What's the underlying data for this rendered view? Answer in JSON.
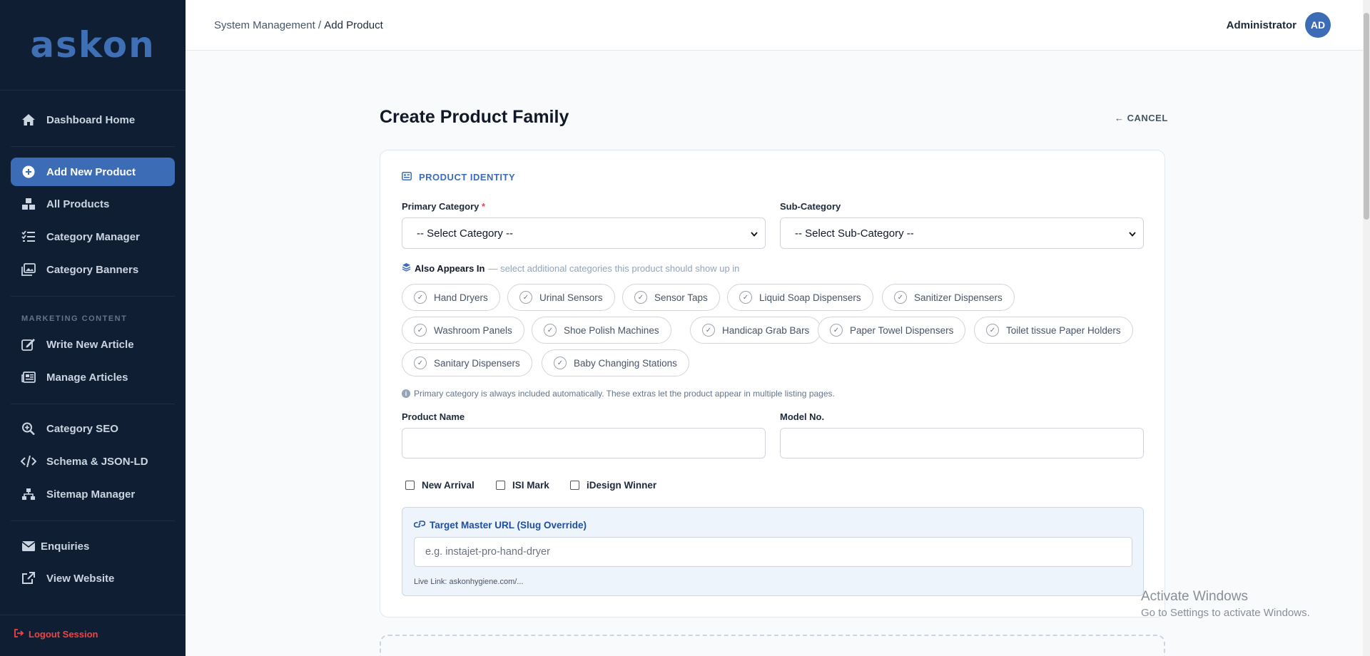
{
  "sidebar": {
    "logo": "askon",
    "items": [
      {
        "label": "Dashboard Home",
        "icon": "home-icon"
      },
      {
        "label": "Add New Product",
        "icon": "plus-circle-icon",
        "active": true
      },
      {
        "label": "All Products",
        "icon": "boxes-icon"
      },
      {
        "label": "Category Manager",
        "icon": "list-check-icon"
      },
      {
        "label": "Category Banners",
        "icon": "images-icon"
      },
      {
        "label": "Write New Article",
        "icon": "edit-icon"
      },
      {
        "label": "Manage Articles",
        "icon": "newspaper-icon"
      },
      {
        "label": "Category SEO",
        "icon": "search-plus-icon"
      },
      {
        "label": "Schema & JSON-LD",
        "icon": "code-icon"
      },
      {
        "label": "Sitemap Manager",
        "icon": "sitemap-icon"
      },
      {
        "label": "Enquiries",
        "icon": "envelope-icon"
      },
      {
        "label": "View Website",
        "icon": "external-link-icon"
      }
    ],
    "section_marketing": "MARKETING CONTENT",
    "logout": "Logout Session"
  },
  "topbar": {
    "breadcrumb_parent": "System Management",
    "breadcrumb_sep": " / ",
    "breadcrumb_current": "Add Product",
    "user_name": "Administrator",
    "avatar_initials": "AD"
  },
  "main": {
    "title": "Create Product Family",
    "cancel": "CANCEL",
    "section_title": "PRODUCT IDENTITY",
    "primary_category_label": "Primary Category",
    "required_mark": "*",
    "primary_category_value": "-- Select Category --",
    "sub_category_label": "Sub-Category",
    "sub_category_value": "-- Select Sub-Category --",
    "also_appears_title": "Also Appears In",
    "also_appears_hint": "— select additional categories this product should show up in",
    "chips": [
      "Hand Dryers",
      "Urinal Sensors",
      "Sensor Taps",
      "Liquid Soap Dispensers",
      "Sanitizer Dispensers",
      "Washroom Panels",
      "Shoe Polish Machines",
      "Handicap Grab Bars",
      "Paper Towel Dispensers",
      "Toilet tissue Paper Holders",
      "Sanitary Dispensers",
      "Baby Changing Stations"
    ],
    "note": "Primary category is always included automatically. These extras let the product appear in multiple listing pages.",
    "product_name_label": "Product Name",
    "model_no_label": "Model No.",
    "checkboxes": [
      "New Arrival",
      "ISI Mark",
      "iDesign Winner"
    ],
    "url_label": "Target Master URL (Slug Override)",
    "url_placeholder": "e.g. instajet-pro-hand-dryer",
    "live_link": "Live Link: askonhygiene.com/..."
  },
  "watermark": {
    "line1": "Activate Windows",
    "line2": "Go to Settings to activate Windows."
  },
  "colors": {
    "sidebar_bg": "#101e33",
    "accent": "#3d6cb6",
    "danger": "#ef4444"
  }
}
